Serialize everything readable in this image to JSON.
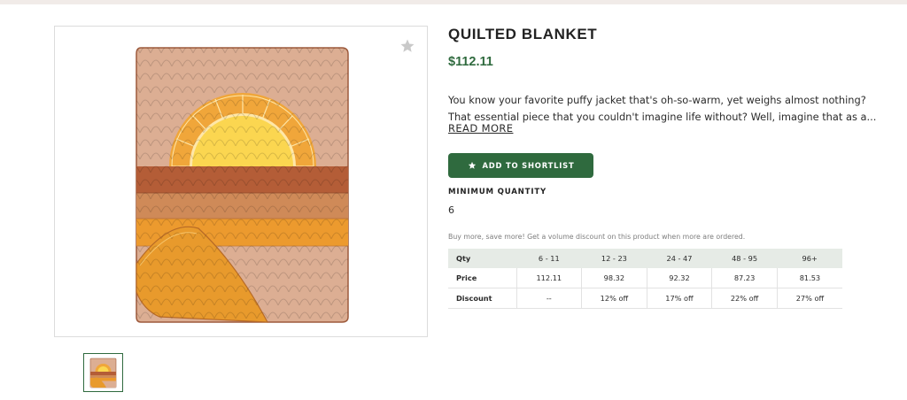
{
  "product": {
    "title": "QUILTED BLANKET",
    "price": "$112.11",
    "description_line1": "You know your favorite puffy jacket that's oh-so-warm, yet weighs almost nothing?",
    "description_line2": "That essential piece that you couldn't imagine life without? Well, imagine that as a...",
    "read_more": "READ MORE",
    "favorite_icon": "star-icon"
  },
  "actions": {
    "add_to_shortlist": "ADD TO SHORTLIST",
    "add_icon": "star-icon"
  },
  "minimum_quantity": {
    "label": "MINIMUM QUANTITY",
    "value": "6"
  },
  "volume": {
    "note": "Buy more, save more! Get a volume discount on this product when more are ordered.",
    "headers": [
      "Qty",
      "6 - 11",
      "12 - 23",
      "24 - 47",
      "48 - 95",
      "96+"
    ],
    "rows": [
      [
        "Price",
        "112.11",
        "98.32",
        "92.32",
        "87.23",
        "81.53"
      ],
      [
        "Discount",
        "--",
        "12% off",
        "17% off",
        "22% off",
        "27% off"
      ]
    ]
  },
  "colors": {
    "brand_green": "#2f6a3e",
    "blanket_base": "#dcae93",
    "sun_yellow": "#fbd650",
    "sun_orange": "#f0a63a",
    "band_rust": "#b45d37",
    "band_tan": "#cf8a58",
    "band_orange": "#ec9a2e"
  }
}
